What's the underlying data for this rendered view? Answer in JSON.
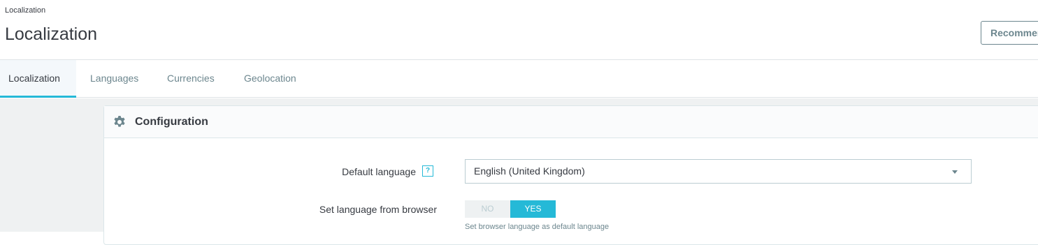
{
  "header": {
    "breadcrumb": "Localization",
    "title": "Localization",
    "recommended_button": "Recommended Modules"
  },
  "tabs": [
    {
      "label": "Localization",
      "active": true
    },
    {
      "label": "Languages",
      "active": false
    },
    {
      "label": "Currencies",
      "active": false
    },
    {
      "label": "Geolocation",
      "active": false
    }
  ],
  "panel": {
    "icon": "gear-icon",
    "title": "Configuration",
    "fields": {
      "default_language": {
        "label": "Default language",
        "help_icon": "?",
        "value": "English (United Kingdom)"
      },
      "language_from_browser": {
        "label": "Set language from browser",
        "no_label": "NO",
        "yes_label": "YES",
        "selected": "YES",
        "help": "Set browser language as default language"
      }
    }
  },
  "colors": {
    "accent": "#25b9d7",
    "text": "#363a41",
    "muted": "#6c868e",
    "background": "#eff1f2"
  }
}
